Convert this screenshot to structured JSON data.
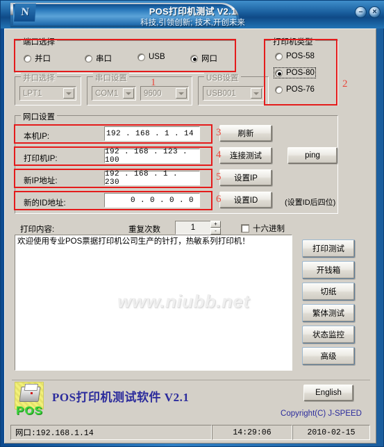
{
  "window": {
    "title": "POS打印机测试 V2.1",
    "subtitle": "科技,引领创新; 技术,开创未来",
    "logo_glyph": "N",
    "minimize_glyph": "–",
    "close_glyph": "×"
  },
  "port_group": {
    "legend": "端口选择",
    "options": [
      {
        "label": "并口",
        "selected": false
      },
      {
        "label": "串口",
        "selected": false
      },
      {
        "label": "USB",
        "selected": false
      },
      {
        "label": "网口",
        "selected": true
      }
    ]
  },
  "printer_type_group": {
    "legend": "打印机类型",
    "options": [
      {
        "label": "POS-58",
        "selected": false
      },
      {
        "label": "POS-80",
        "selected": true
      },
      {
        "label": "POS-76",
        "selected": false
      }
    ]
  },
  "parallel_group": {
    "legend": "并口选择",
    "value": "LPT1",
    "disabled": true
  },
  "serial_group": {
    "legend": "串口设置",
    "port_value": "COM1",
    "baud_value": "9600",
    "disabled": true
  },
  "usb_group": {
    "legend": "USB设置",
    "value": "USB001",
    "disabled": true
  },
  "net_group": {
    "legend": "网口设置",
    "fields": [
      {
        "label": "本机IP:",
        "value": "192 . 168 .   1  .  14"
      },
      {
        "label": "打印机IP:",
        "value": "192 . 168 . 123 . 100"
      },
      {
        "label": "新IP地址:",
        "value": "192 . 168 .   1  . 230"
      },
      {
        "label": "新的ID地址:",
        "value": "  0  .   0  .   0  .   0"
      }
    ],
    "buttons": [
      {
        "label": "刷新"
      },
      {
        "label": "连接测试"
      },
      {
        "label": "设置IP"
      },
      {
        "label": "设置ID"
      }
    ],
    "ping_label": "ping",
    "hint": "(设置ID后四位)"
  },
  "annotations": {
    "numbers": [
      "1",
      "2",
      "3",
      "4",
      "5",
      "6"
    ]
  },
  "print_content": {
    "label": "打印内容:",
    "repeat_label": "重复次数",
    "repeat_value": "1",
    "spin_up": "+",
    "spin_down": "-",
    "hex_label": "十六进制",
    "hex_checked": false,
    "text": "欢迎使用专业POS票据打印机公司生产的针打，热敏系列打印机！",
    "watermark": "www.niubb.net"
  },
  "action_buttons": [
    {
      "label": "打印测试"
    },
    {
      "label": "开钱箱"
    },
    {
      "label": "切纸"
    },
    {
      "label": "繁体测试"
    },
    {
      "label": "状态监控"
    },
    {
      "label": "高级"
    }
  ],
  "footer": {
    "brand": "POS打印机测试软件  V2.1",
    "logo_text": "POS",
    "english_button": "English",
    "copyright": "Copyright(C) J-SPEED"
  },
  "statusbar": {
    "connection": "网口:192.168.1.14",
    "time": "14:29:06",
    "date": "2010-02-15"
  },
  "colors": {
    "accent_red": "#e41b1b",
    "annotation_red": "#e8473c",
    "title_blue": "#1a5f9e",
    "brand_blue": "#2b2b9c",
    "face": "#d4d0c8"
  }
}
